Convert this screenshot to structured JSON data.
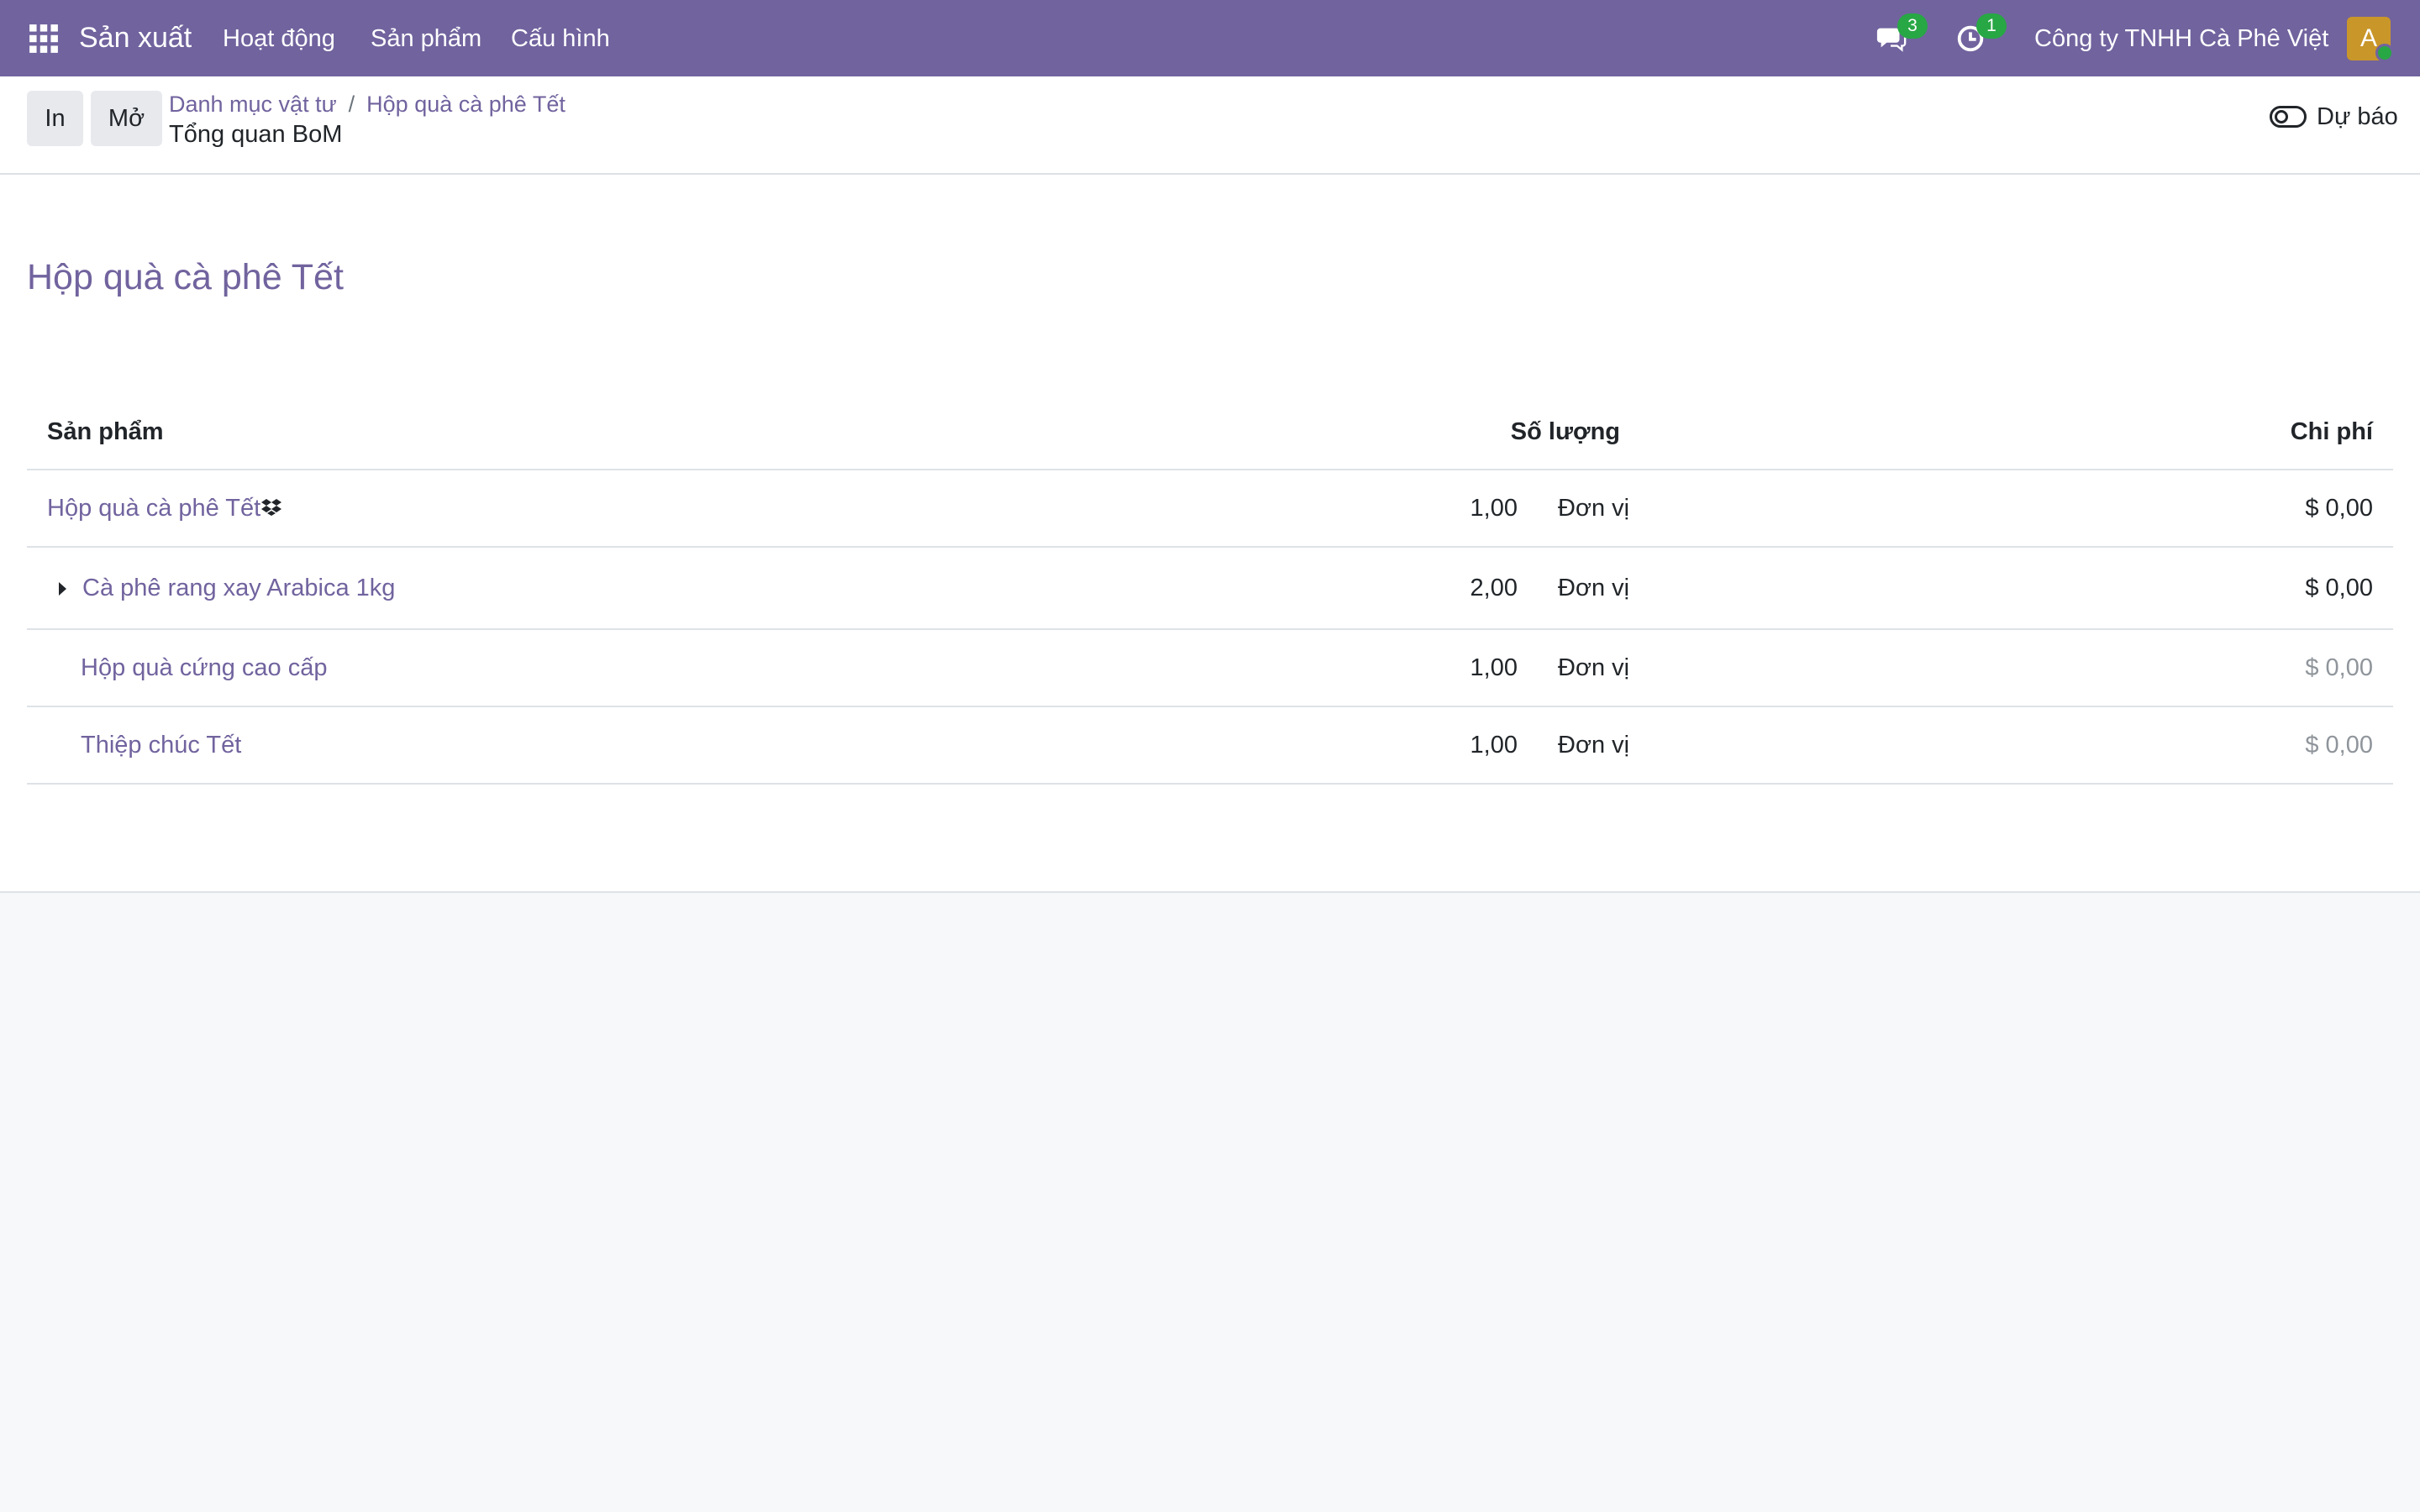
{
  "navbar": {
    "app_name": "Sản xuất",
    "menu": [
      "Hoạt động",
      "Sản phẩm",
      "Cấu hình"
    ],
    "messages_count": "3",
    "activities_count": "1",
    "company": "Công ty TNHH Cà Phê Việt",
    "avatar_initial": "A",
    "colors": {
      "bar": "#71639e",
      "badge": "#28a745",
      "avatar": "#c9962a"
    }
  },
  "control_panel": {
    "print_label": "In",
    "open_label": "Mở",
    "breadcrumbs": [
      "Danh mục vật tư",
      "Hộp quà cà phê Tết"
    ],
    "breadcrumb_separator": "/",
    "current": "Tổng quan BoM",
    "forecast_label": "Dự báo"
  },
  "report": {
    "title": "Hộp quà cà phê Tết",
    "columns": {
      "product": "Sản phẩm",
      "quantity": "Số lượng",
      "cost": "Chi phí"
    },
    "rows": [
      {
        "product": "Hộp quà cà phê Tết",
        "quantity": "1,00",
        "uom": "Đơn vị",
        "cost": "$ 0,00"
      },
      {
        "product": "Cà phê rang xay Arabica 1kg",
        "quantity": "2,00",
        "uom": "Đơn vị",
        "cost": "$ 0,00"
      },
      {
        "product": "Hộp quà cứng cao cấp",
        "quantity": "1,00",
        "uom": "Đơn vị",
        "cost": "$ 0,00"
      },
      {
        "product": "Thiệp chúc Tết",
        "quantity": "1,00",
        "uom": "Đơn vị",
        "cost": "$ 0,00"
      }
    ]
  },
  "icons": [
    "apps-grid-icon",
    "chat-icon",
    "clock-activity-icon",
    "toggle-icon",
    "caret-right-icon",
    "dropbox-boxes-icon"
  ]
}
